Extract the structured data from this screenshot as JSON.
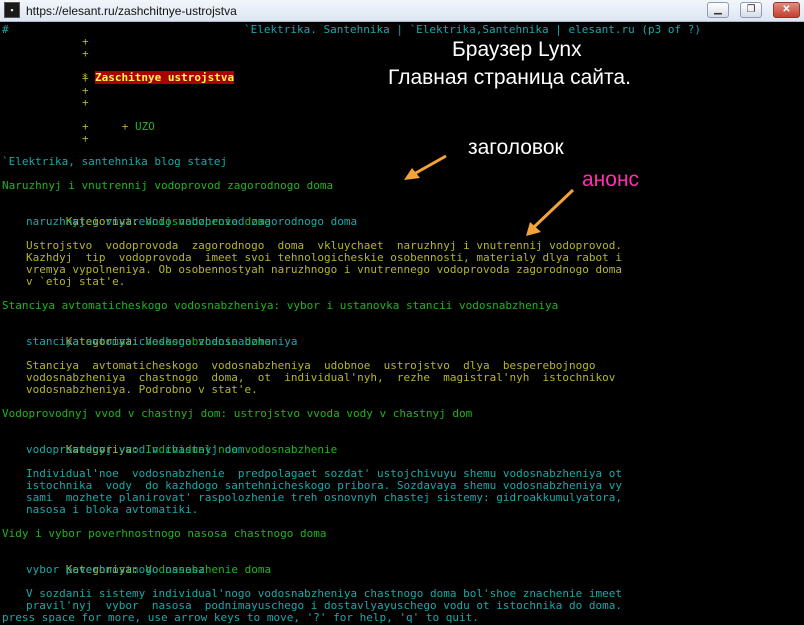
{
  "window": {
    "title": "https://elesant.ru/zashchitnye-ustrojstva",
    "icon": "terminal-icon"
  },
  "terminal": {
    "header_left": "#",
    "header_right": "`Elektrika. Santehnika | `Elektrika,Santehnika | elesant.ru (p3 of ?)",
    "menu": {
      "plus": "+",
      "current_marker": "*",
      "current_item": "Zaschitnye ustrojstva",
      "uzo": "UZO"
    },
    "blog_heading": "`Elektrika, santehnika blog statej",
    "articles": [
      {
        "title": "Naruzhnyj i vnutrennij vodoprovod zagorodnogo doma",
        "category_label": "Kategoriya:",
        "category": "Vodosnabzhenie doma",
        "slug": "naruzhnyj i vnutrennij vodoprovod zagorodnogo doma",
        "teaser": [
          "Ustrojstvo  vodoprovoda  zagorodnogo  doma  vkluychaet  naruzhnyj i vnutrennij vodoprovod.",
          "Kazhdyj  tip  vodoprovoda  imeet svoi tehnologicheskie osobennosti, materialy dlya rabot i",
          "vremya vypolneniya. Ob osobennostyah naruzhnogo i vnutrennego vodoprovoda zagorodnogo doma",
          "v `etoj stat'e."
        ]
      },
      {
        "title": "Stanciya avtomaticheskogo vodosnabzheniya: vybor i ustanovka stancii vodosnabzheniya",
        "category_label": "Kategoriya:",
        "category": "Vodosnabzhenie doma",
        "slug": "stanciya avtomaticheskogo vodosnabzheniya",
        "teaser": [
          "Stanciya  avtomaticheskogo  vodosnabzheniya  udobnoe  ustrojstvo  dlya  besperebojnogo",
          "vodosnabzheniya  chastnogo  doma,  ot  individual'nyh,  rezhe  magistral'nyh  istochnikov",
          "vodosnabzheniya. Podrobno v stat'e."
        ]
      },
      {
        "title": "Vodoprovodnyj vvod v chastnyj dom: ustrojstvo vvoda vody v chastnyj dom",
        "category_label": "Kategoriya:",
        "category": "Individual'noe vodosnabzhenie",
        "slug": "vodoprovodnyj vvod v chastnyj dom",
        "teaser": [
          "Individual'noe  vodosnabzhenie  predpolagaet sozdat' ustojchivuyu shemu vodosnabzheniya ot",
          "istochnika  vody  do kazhdogo santehnicheskogo pribora. Sozdavaya shemu vodosnabzheniya vy",
          "sami  mozhete planirovat' raspolozhenie treh osnovnyh chastej sistemy: gidroakkumulyatora,",
          "nasosa i bloka avtomatiki."
        ]
      },
      {
        "title": "Vidy i vybor poverhnostnogo nasosa chastnogo doma",
        "category_label": "Kategoriya:",
        "category": "Vodosnabzhenie doma",
        "slug": "vybor poverhnostnogo nasosa",
        "teaser": [
          "V sozdanii sistemy individual'nogo vodosnabzheniya chastnogo doma bol'shoe znachenie imeet",
          "pravil'nyj  vybor  nasosa  podnimayuschego i dostavlyayuschego vodu ot istochnika do doma."
        ]
      }
    ],
    "status_line": "press space for more, use arrow keys to move, '?' for help, 'q' to quit."
  },
  "annotations": {
    "browser_label": "Браузер Lynx",
    "home_label": "Главная страница сайта.",
    "heading_label": "заголовок",
    "teaser_label": "анонс",
    "colors": {
      "arrow": "#f2a33a",
      "white_text": "#ffffff",
      "pink_text": "#ff2fb0"
    }
  }
}
